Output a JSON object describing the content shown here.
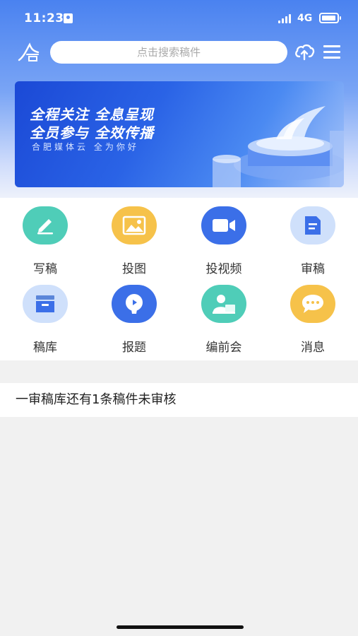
{
  "status_bar": {
    "time": "11:23",
    "network": "4G"
  },
  "header": {
    "search_placeholder": "点击搜索稿件"
  },
  "banner": {
    "line1": "全程关注  全息呈现",
    "line2": "全员参与  全效传播",
    "subtitle": "合肥媒体云  全为你好"
  },
  "grid": {
    "items": [
      {
        "label": "写稿",
        "icon": "pen-icon",
        "color": "#4fcdb8"
      },
      {
        "label": "投图",
        "icon": "image-icon",
        "color": "#f6c24a"
      },
      {
        "label": "投视频",
        "icon": "video-icon",
        "color": "#3b6fe8"
      },
      {
        "label": "审稿",
        "icon": "document-icon",
        "color": "#cfe0fb"
      },
      {
        "label": "稿库",
        "icon": "archive-icon",
        "color": "#cfe0fb"
      },
      {
        "label": "报题",
        "icon": "idea-icon",
        "color": "#3b6fe8"
      },
      {
        "label": "编前会",
        "icon": "meeting-icon",
        "color": "#4fcdb8"
      },
      {
        "label": "消息",
        "icon": "message-icon",
        "color": "#f6c24a"
      }
    ]
  },
  "notice": {
    "text": "一审稿库还有1条稿件未审核"
  }
}
